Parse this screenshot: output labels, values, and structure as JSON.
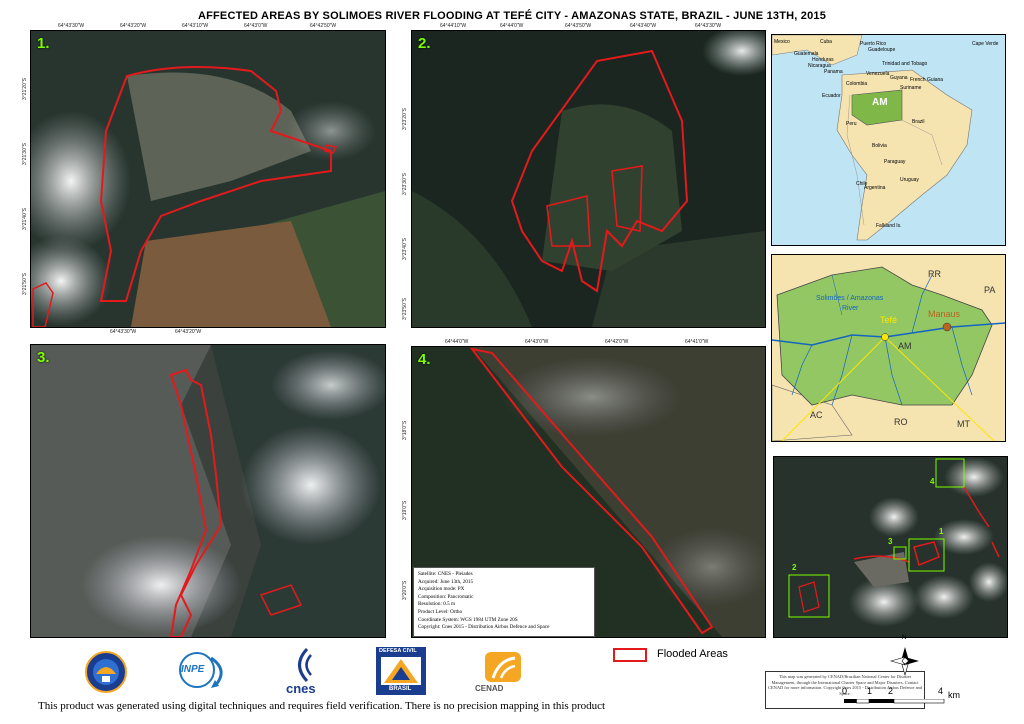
{
  "title": "AFFECTED AREAS BY SOLIMOES RIVER FLOODING AT TEFÉ CITY - AMAZONAS STATE, BRAZIL - JUNE 13TH, 2015",
  "panels": {
    "p1": {
      "label": "1."
    },
    "p2": {
      "label": "2."
    },
    "p3": {
      "label": "3."
    },
    "p4": {
      "label": "4."
    }
  },
  "ticks": {
    "p1_top": [
      "64°43'30\"W",
      "64°43'20\"W",
      "64°43'10\"W",
      "64°43'0\"W",
      "64°42'50\"W"
    ],
    "p1_left": [
      "3°21'20\"S",
      "3°21'30\"S",
      "3°21'40\"S",
      "3°21'50\"S"
    ],
    "p1_bottom": [
      "64°43'30\"W",
      "64°43'20\"W"
    ],
    "p2_top": [
      "64°44'10\"W",
      "64°44'0\"W",
      "64°43'50\"W",
      "64°43'40\"W",
      "64°43'30\"W"
    ],
    "p2_left": [
      "3°23'20\"S",
      "3°23'30\"S",
      "3°23'40\"S",
      "3°23'50\"S"
    ],
    "p4_top": [
      "64°44'0\"W",
      "64°43'0\"W",
      "64°42'0\"W",
      "64°41'0\"W"
    ],
    "p4_left": [
      "3°18'0\"S",
      "3°19'0\"S",
      "3°20'0\"S"
    ]
  },
  "inset_south_america": {
    "labels": [
      {
        "text": "Mexico"
      },
      {
        "text": "Cuba"
      },
      {
        "text": "Puerto Rico"
      },
      {
        "text": "Guadeloupe"
      },
      {
        "text": "Cape Verde"
      },
      {
        "text": "Guatemala"
      },
      {
        "text": "Honduras"
      },
      {
        "text": "Nicaragua"
      },
      {
        "text": "Panama"
      },
      {
        "text": "Venezuela"
      },
      {
        "text": "Trinidad and Tobago"
      },
      {
        "text": "Guyana"
      },
      {
        "text": "French Guiana"
      },
      {
        "text": "Colombia"
      },
      {
        "text": "Suriname"
      },
      {
        "text": "Ecuador"
      },
      {
        "text": "Peru"
      },
      {
        "text": "Brazil"
      },
      {
        "text": "Bolivia"
      },
      {
        "text": "Paraguay"
      },
      {
        "text": "Chile"
      },
      {
        "text": "Argentina"
      },
      {
        "text": "Uruguay"
      },
      {
        "text": "Falkland Is."
      }
    ],
    "state": "AM",
    "state_color": "#7fb848"
  },
  "inset_amazonas": {
    "state_labels": [
      {
        "text": "RR"
      },
      {
        "text": "PA"
      },
      {
        "text": "AM"
      },
      {
        "text": "AC"
      },
      {
        "text": "RO"
      },
      {
        "text": "MT"
      }
    ],
    "river_labels": [
      "Solimões / Amazonas",
      "River"
    ],
    "cities": [
      {
        "name": "Tefé",
        "color": "#ffe600"
      },
      {
        "name": "Manaus",
        "color": "#b5651d"
      }
    ]
  },
  "overview": {
    "boxes": [
      {
        "label": "1"
      },
      {
        "label": "2"
      },
      {
        "label": "3"
      },
      {
        "label": "4"
      }
    ]
  },
  "credits": {
    "lines": [
      "Satellite: CNES - Pleiades",
      "Acquired: June 13th, 2015",
      "Acquisition mode: PX",
      "Composition: Pancromatic",
      "Resolution: 0.5 m",
      "Product Level: Ortho",
      "Coordinate System: WGS 1984 UTM Zone 20S",
      "Copyright: Cnes 2015 - Distribution Airbus Defence and Space"
    ]
  },
  "legend": {
    "label": "Flooded Areas",
    "color": "#e31a1c"
  },
  "scale": {
    "labels": [
      "0",
      "1",
      "2",
      "4"
    ],
    "unit": "km"
  },
  "north_arrow": "N",
  "logos": [
    {
      "name": "cenad-emblem",
      "text": ""
    },
    {
      "name": "inpe",
      "text": "INPE"
    },
    {
      "name": "cnes",
      "text": "cnes"
    },
    {
      "name": "defesa-civil",
      "text_top": "DEFESA CIVIL",
      "text_bottom": "BRASIL"
    },
    {
      "name": "cenad",
      "text": "CENAD"
    }
  ],
  "footer": "This product was generated using digital techniques and requires field verification. There is no precision mapping in this product",
  "note": "This map was generated by CENAD/Brazilian National Center for Disaster Management, through the International Charter Space and Major Disasters. Contact CENAD for more information. Copyright Cnes 2015 - Distribution Airbus Defence and Space."
}
